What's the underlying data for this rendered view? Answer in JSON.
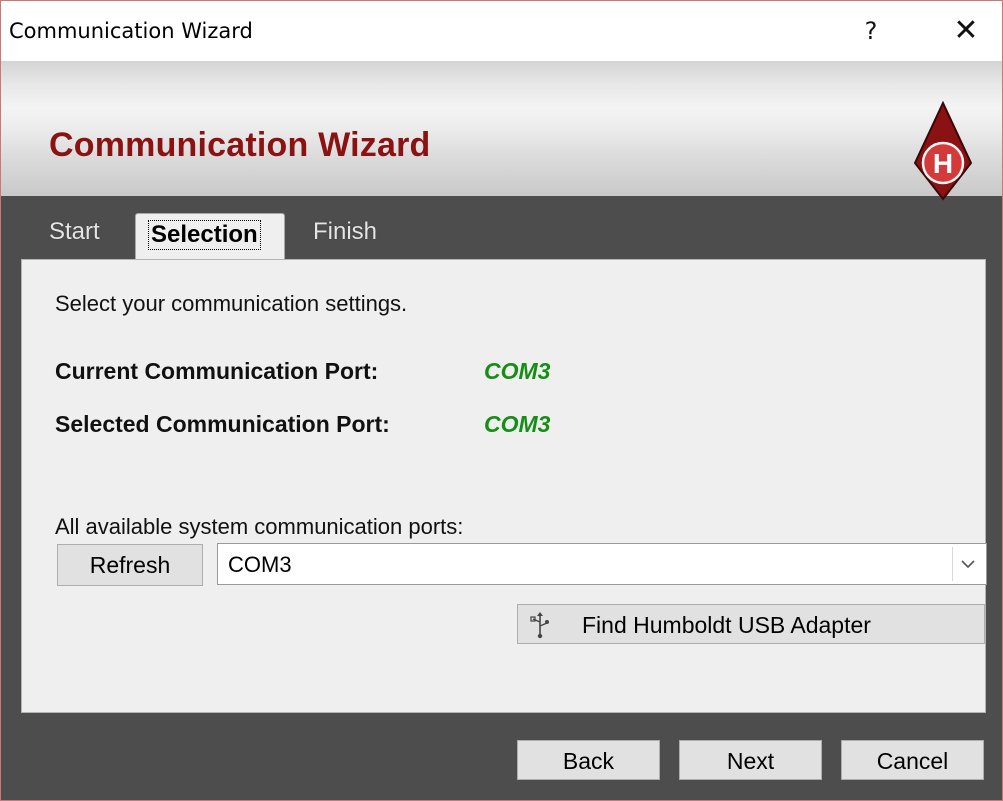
{
  "window": {
    "title": "Communication Wizard",
    "help_label": "?",
    "close_label": "✕"
  },
  "banner": {
    "title": "Communication Wizard",
    "logo_letter": "H"
  },
  "tabs": [
    {
      "label": "Start"
    },
    {
      "label": "Selection",
      "selected": true
    },
    {
      "label": "Finish"
    }
  ],
  "panel": {
    "intro": "Select your communication settings.",
    "current_port_label": "Current Communication Port:",
    "current_port_value": "COM3",
    "selected_port_label": "Selected Communication Port:",
    "selected_port_value": "COM3",
    "available_ports_label": "All available system communication ports:",
    "refresh_label": "Refresh",
    "port_select_value": "COM3",
    "find_adapter_label": "Find Humboldt USB Adapter"
  },
  "footer": {
    "back_label": "Back",
    "next_label": "Next",
    "cancel_label": "Cancel"
  },
  "colors": {
    "brand_red": "#8b1212",
    "port_green": "#168e16",
    "frame_dark": "#4d4d4d"
  },
  "icons": [
    "help-icon",
    "close-icon",
    "humboldt-logo",
    "chevron-down-icon",
    "usb-icon"
  ]
}
